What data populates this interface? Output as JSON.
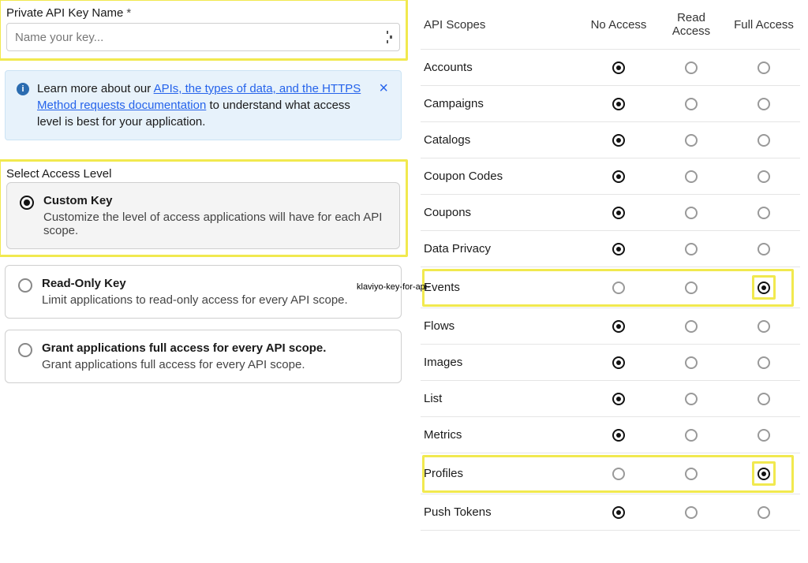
{
  "key_name": {
    "label": "Private API Key Name",
    "placeholder": "Name your key..."
  },
  "banner": {
    "prefix": "Learn more about our ",
    "link": "APIs, the types of data, and the HTTPS Method requests documentation",
    "suffix": " to understand what access level is best for your application."
  },
  "access_level": {
    "label": "Select Access Level",
    "options": [
      {
        "title": "Custom Key",
        "desc": "Customize the level of access applications will have for each API scope.",
        "selected": true
      },
      {
        "title": "Read-Only Key",
        "desc": "Limit applications to read-only access for every API scope.",
        "selected": false
      },
      {
        "title": "Grant applications full access for every API scope.",
        "desc": "Grant applications full access for every API scope.",
        "selected": false
      }
    ]
  },
  "caption": "klaviyo-key-for-api-",
  "scopes": {
    "headers": [
      "API Scopes",
      "No Access",
      "Read Access",
      "Full Access"
    ],
    "rows": [
      {
        "name": "Accounts",
        "selected": "no",
        "highlight": false
      },
      {
        "name": "Campaigns",
        "selected": "no",
        "highlight": false
      },
      {
        "name": "Catalogs",
        "selected": "no",
        "highlight": false
      },
      {
        "name": "Coupon Codes",
        "selected": "no",
        "highlight": false
      },
      {
        "name": "Coupons",
        "selected": "no",
        "highlight": false
      },
      {
        "name": "Data Privacy",
        "selected": "no",
        "highlight": false
      },
      {
        "name": "Events",
        "selected": "full",
        "highlight": true
      },
      {
        "name": "Flows",
        "selected": "no",
        "highlight": false
      },
      {
        "name": "Images",
        "selected": "no",
        "highlight": false
      },
      {
        "name": "List",
        "selected": "no",
        "highlight": false
      },
      {
        "name": "Metrics",
        "selected": "no",
        "highlight": false
      },
      {
        "name": "Profiles",
        "selected": "full",
        "highlight": true
      },
      {
        "name": "Push Tokens",
        "selected": "no",
        "highlight": false
      }
    ]
  }
}
